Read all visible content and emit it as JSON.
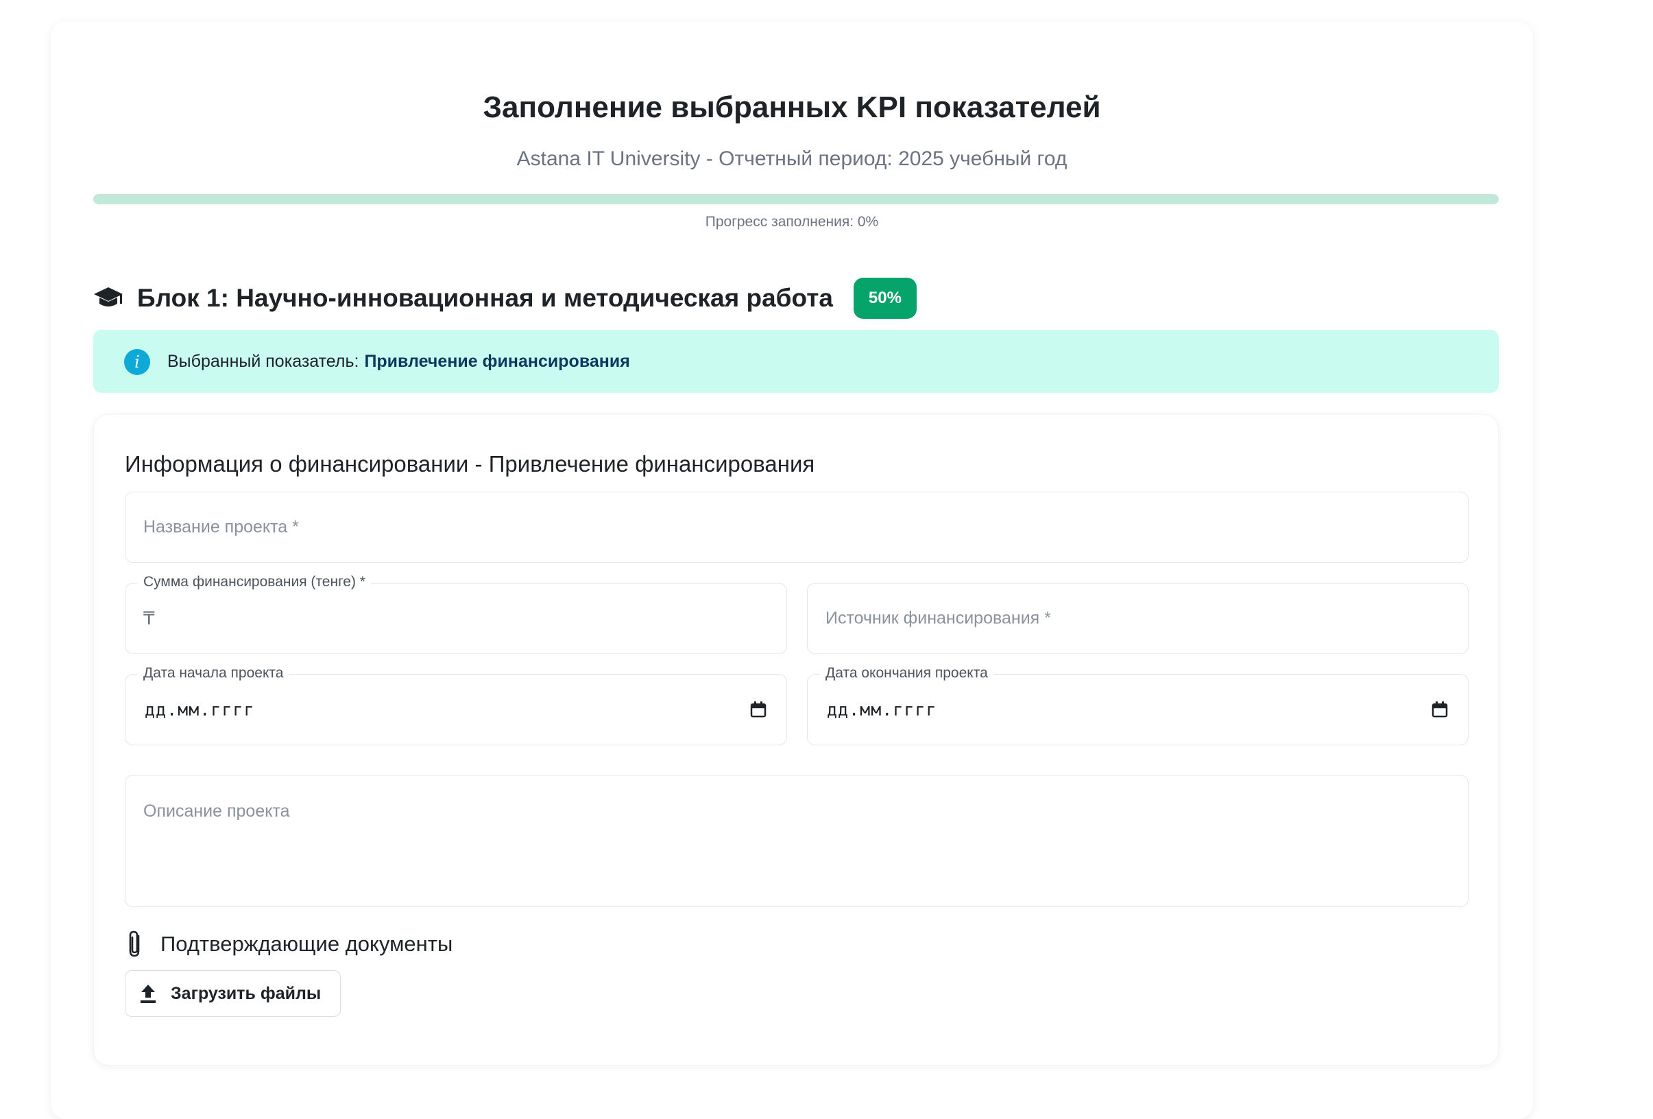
{
  "header": {
    "title": "Заполнение выбранных KPI показателей",
    "subtitle": "Astana IT University - Отчетный период: 2025 учебный год"
  },
  "progress": {
    "percent": 0,
    "text": "Прогресс заполнения: 0%",
    "track_color": "#c2e8d9"
  },
  "block": {
    "title": "Блок 1: Научно-инновационная и методическая работа",
    "badge": "50%",
    "icon": "graduation-cap-icon",
    "badge_color": "#06a36b"
  },
  "alert": {
    "label": "Выбранный показатель:",
    "value": "Привлечение финансирования",
    "icon": "info-icon",
    "background": "#c9fbf1"
  },
  "form": {
    "section_title": "Информация о финансировании - Привлечение финансирования",
    "project_name": {
      "placeholder": "Название проекта *",
      "value": ""
    },
    "amount": {
      "label": "Сумма финансирования (тенге) *",
      "prefix": "₸",
      "value": ""
    },
    "source": {
      "placeholder": "Источник финансирования *",
      "value": ""
    },
    "start_date": {
      "label": "Дата начала проекта",
      "value": "дд.мм.гггг",
      "icon": "calendar-icon"
    },
    "end_date": {
      "label": "Дата окончания проекта",
      "value": "дд.мм.гггг",
      "icon": "calendar-icon"
    },
    "description": {
      "placeholder": "Описание проекта",
      "value": ""
    },
    "documents": {
      "title": "Подтверждающие документы",
      "icon": "paperclip-icon",
      "upload_label": "Загрузить файлы",
      "upload_icon": "upload-icon"
    }
  }
}
